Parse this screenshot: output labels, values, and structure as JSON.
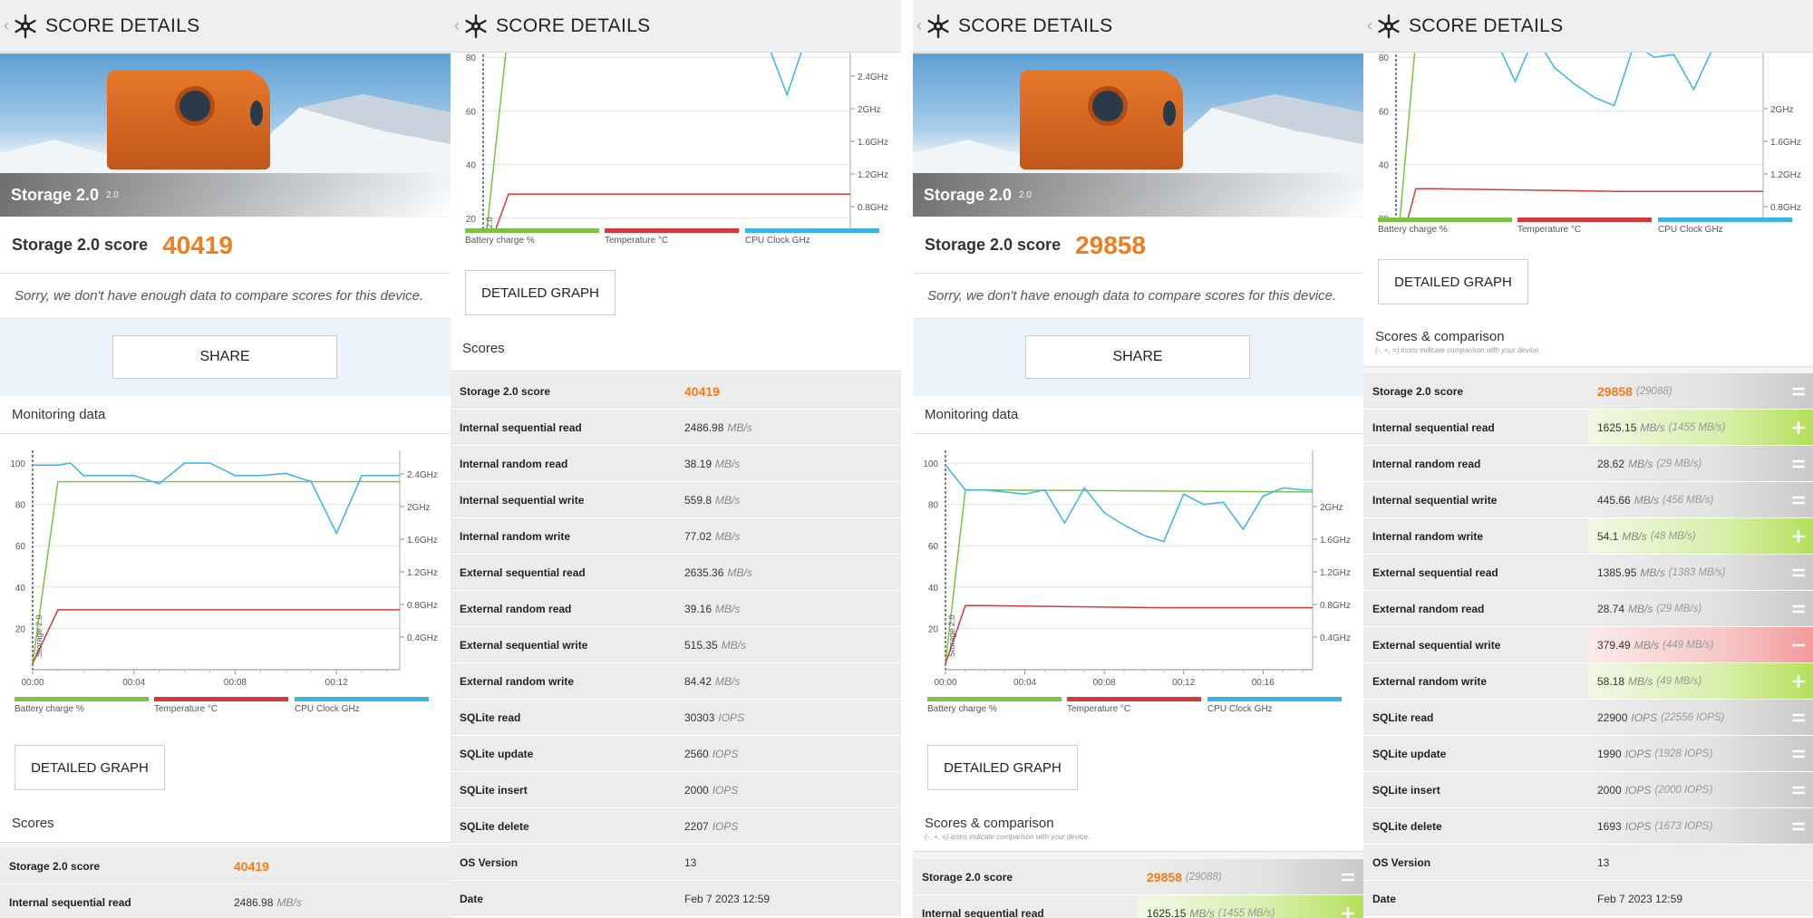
{
  "header": {
    "title": "SCORE DETAILS"
  },
  "hero": {
    "title": "Storage 2.0",
    "version": "2.0"
  },
  "labels": {
    "score_label": "Storage 2.0 score",
    "sorry": "Sorry, we don't have enough data to compare scores for this device.",
    "share": "SHARE",
    "monitoring": "Monitoring data",
    "detailed_graph": "DETAILED GRAPH",
    "scores": "Scores",
    "scores_comparison": "Scores & comparison",
    "comparison_note": "(-, +, =) icons indicate comparison with your device."
  },
  "legend": {
    "battery": "Battery charge %",
    "temperature": "Temperature °C",
    "cpu": "CPU Clock GHz"
  },
  "colors": {
    "orange": "#f07d1e",
    "battery": "#7cc243",
    "temperature": "#d43a3a",
    "cpu": "#3ab4e6"
  },
  "runA": {
    "score": "40419",
    "rows": [
      {
        "name": "Storage 2.0 score",
        "value": "40419",
        "unit": "",
        "highlight": true
      },
      {
        "name": "Internal sequential read",
        "value": "2486.98",
        "unit": "MB/s"
      },
      {
        "name": "Internal random read",
        "value": "38.19",
        "unit": "MB/s"
      },
      {
        "name": "Internal sequential write",
        "value": "559.8",
        "unit": "MB/s"
      },
      {
        "name": "Internal random write",
        "value": "77.02",
        "unit": "MB/s"
      },
      {
        "name": "External sequential read",
        "value": "2635.36",
        "unit": "MB/s"
      },
      {
        "name": "External random read",
        "value": "39.16",
        "unit": "MB/s"
      },
      {
        "name": "External sequential write",
        "value": "515.35",
        "unit": "MB/s"
      },
      {
        "name": "External random write",
        "value": "84.42",
        "unit": "MB/s"
      },
      {
        "name": "SQLite read",
        "value": "30303",
        "unit": "IOPS"
      },
      {
        "name": "SQLite update",
        "value": "2560",
        "unit": "IOPS"
      },
      {
        "name": "SQLite insert",
        "value": "2000",
        "unit": "IOPS"
      },
      {
        "name": "SQLite delete",
        "value": "2207",
        "unit": "IOPS"
      },
      {
        "name": "OS Version",
        "value": "13",
        "unit": ""
      },
      {
        "name": "Date",
        "value": "Feb 7 2023 12:59",
        "unit": ""
      }
    ]
  },
  "runB": {
    "score": "29858",
    "rows": [
      {
        "name": "Storage 2.0 score",
        "value": "29858",
        "unit": "",
        "cmp": "(29088)",
        "state": "equal",
        "highlight": true
      },
      {
        "name": "Internal sequential read",
        "value": "1625.15",
        "unit": "MB/s",
        "cmp": "(1455 MB/s)",
        "state": "plus"
      },
      {
        "name": "Internal random read",
        "value": "28.62",
        "unit": "MB/s",
        "cmp": "(29 MB/s)",
        "state": "equal"
      },
      {
        "name": "Internal sequential write",
        "value": "445.66",
        "unit": "MB/s",
        "cmp": "(456 MB/s)",
        "state": "equal"
      },
      {
        "name": "Internal random write",
        "value": "54.1",
        "unit": "MB/s",
        "cmp": "(48 MB/s)",
        "state": "plus"
      },
      {
        "name": "External sequential read",
        "value": "1385.95",
        "unit": "MB/s",
        "cmp": "(1383 MB/s)",
        "state": "equal"
      },
      {
        "name": "External random read",
        "value": "28.74",
        "unit": "MB/s",
        "cmp": "(29 MB/s)",
        "state": "equal"
      },
      {
        "name": "External sequential write",
        "value": "379.49",
        "unit": "MB/s",
        "cmp": "(449 MB/s)",
        "state": "minus"
      },
      {
        "name": "External random write",
        "value": "58.18",
        "unit": "MB/s",
        "cmp": "(49 MB/s)",
        "state": "plus"
      },
      {
        "name": "SQLite read",
        "value": "22900",
        "unit": "IOPS",
        "cmp": "(22556 IOPS)",
        "state": "equal"
      },
      {
        "name": "SQLite update",
        "value": "1990",
        "unit": "IOPS",
        "cmp": "(1928 IOPS)",
        "state": "equal"
      },
      {
        "name": "SQLite insert",
        "value": "2000",
        "unit": "IOPS",
        "cmp": "(2000 IOPS)",
        "state": "equal"
      },
      {
        "name": "SQLite delete",
        "value": "1693",
        "unit": "IOPS",
        "cmp": "(1673 IOPS)",
        "state": "equal"
      },
      {
        "name": "OS Version",
        "value": "13",
        "unit": "",
        "state": "none"
      },
      {
        "name": "Date",
        "value": "Feb 7 2023 12:59",
        "unit": "",
        "state": "none"
      }
    ]
  },
  "chart_data": [
    {
      "type": "line",
      "title": "",
      "ylim": [
        0,
        100
      ],
      "yticks": [
        "20",
        "40",
        "60",
        "80",
        "100"
      ],
      "xticks": [
        "00:00",
        "00:04",
        "00:08",
        "00:12"
      ],
      "xmax_min": 14.5,
      "cpu_ticks": [
        "0.4GHz",
        "0.8GHz",
        "1.2GHz",
        "1.6GHz",
        "2GHz",
        "2.4GHz"
      ],
      "marker": "Storage 2.0",
      "series": [
        {
          "name": "Battery charge %",
          "x": [
            0,
            1,
            2,
            14.5
          ],
          "y": [
            3,
            91,
            91,
            91
          ]
        },
        {
          "name": "Temperature °C",
          "x": [
            0,
            1,
            2,
            14.5
          ],
          "y": [
            3,
            29,
            29,
            29
          ]
        },
        {
          "name": "CPU Clock GHz",
          "x": [
            0,
            1,
            1.5,
            2,
            3,
            4,
            5,
            6,
            7,
            8,
            9,
            10,
            11,
            12,
            13,
            14,
            14.5
          ],
          "y": [
            99,
            99,
            100,
            94,
            94,
            94,
            90,
            100,
            100,
            94,
            94,
            95,
            91,
            66,
            94,
            94,
            94
          ]
        }
      ]
    },
    {
      "type": "line",
      "title": "",
      "ylim": [
        0,
        100
      ],
      "yticks": [
        "20",
        "40",
        "60",
        "80",
        "100"
      ],
      "xticks": [
        "00:00",
        "00:04",
        "00:08",
        "00:12",
        "00:16"
      ],
      "xmax_min": 18.5,
      "cpu_ticks": [
        "0.4GHz",
        "0.8GHz",
        "1.2GHz",
        "1.6GHz",
        "2GHz"
      ],
      "marker": "Storage 2.0",
      "series": [
        {
          "name": "Battery charge %",
          "x": [
            0,
            1,
            2,
            18.5
          ],
          "y": [
            3,
            87,
            87,
            86
          ]
        },
        {
          "name": "Temperature °C",
          "x": [
            0,
            1,
            2,
            11,
            18.5
          ],
          "y": [
            3,
            31,
            31,
            30,
            30
          ]
        },
        {
          "name": "CPU Clock GHz",
          "x": [
            0,
            1,
            2,
            3,
            4,
            5,
            6,
            7,
            8,
            9,
            10,
            11,
            12,
            13,
            14,
            15,
            16,
            17,
            18,
            18.5
          ],
          "y": [
            99,
            87,
            87,
            86,
            85,
            87,
            71,
            88,
            76,
            70,
            65,
            62,
            85,
            80,
            81,
            68,
            84,
            88,
            87,
            87
          ]
        }
      ]
    }
  ]
}
